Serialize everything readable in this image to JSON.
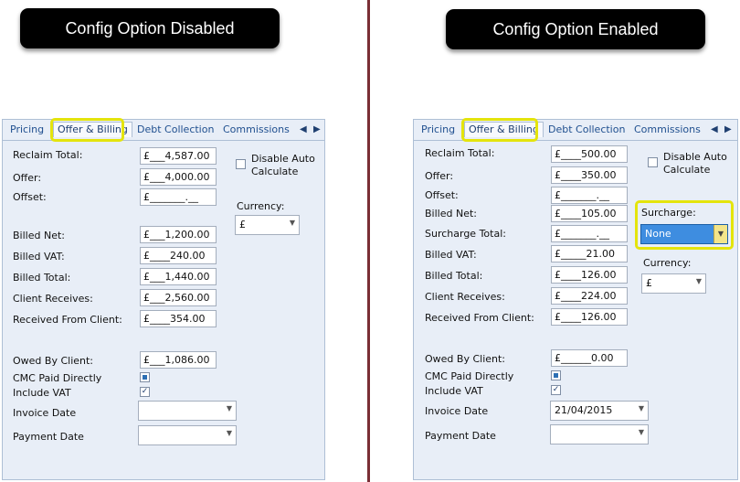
{
  "callouts": {
    "left": "Config Option Disabled",
    "right": "Config Option Enabled"
  },
  "tabs": {
    "pricing": "Pricing",
    "offer_billing": "Offer & Billing",
    "debt_collection": "Debt Collection",
    "commissions": "Commissions"
  },
  "left": {
    "labels": {
      "reclaim_total": "Reclaim Total:",
      "offer": "Offer:",
      "offset": "Offset:",
      "billed_net": "Billed Net:",
      "billed_vat": "Billed VAT:",
      "billed_total": "Billed Total:",
      "client_receives": "Client Receives:",
      "received_from_client": "Received From Client:",
      "owed_by_client": "Owed By Client:",
      "cmc_paid_directly": "CMC Paid Directly",
      "include_vat": "Include VAT",
      "invoice_date": "Invoice Date",
      "payment_date": "Payment Date",
      "disable_auto_calc": "Disable Auto\nCalculate",
      "currency": "Currency:"
    },
    "values": {
      "reclaim_total": "£___4,587.00",
      "offer": "£___4,000.00",
      "offset": "£_______.__",
      "billed_net": "£___1,200.00",
      "billed_vat": "£____240.00",
      "billed_total": "£___1,440.00",
      "client_receives": "£___2,560.00",
      "received_from_client": "£____354.00",
      "owed_by_client": "£___1,086.00",
      "currency": "£",
      "invoice_date": "",
      "payment_date": ""
    }
  },
  "right": {
    "labels": {
      "reclaim_total": "Reclaim Total:",
      "offer": "Offer:",
      "offset": "Offset:",
      "billed_net": "Billed Net:",
      "surcharge_total": "Surcharge Total:",
      "billed_vat": "Billed VAT:",
      "billed_total": "Billed Total:",
      "client_receives": "Client Receives:",
      "received_from_client": "Received From Client:",
      "owed_by_client": "Owed By Client:",
      "cmc_paid_directly": "CMC Paid Directly",
      "include_vat": "Include VAT",
      "invoice_date": "Invoice Date",
      "payment_date": "Payment Date",
      "disable_auto_calc": "Disable Auto\nCalculate",
      "surcharge": "Surcharge:",
      "currency": "Currency:"
    },
    "values": {
      "reclaim_total": "£____500.00",
      "offer": "£____350.00",
      "offset": "£_______.__",
      "billed_net": "£____105.00",
      "surcharge_total": "£_______.__",
      "billed_vat": "£_____21.00",
      "billed_total": "£____126.00",
      "client_receives": "£____224.00",
      "received_from_client": "£____126.00",
      "owed_by_client": "£______0.00",
      "invoice_date": "21/04/2015",
      "payment_date": "",
      "surcharge": "None",
      "currency": "£"
    }
  },
  "colors": {
    "highlight": "#e4e40c",
    "panel_bg": "#e8eef7",
    "divider": "#7a2e35",
    "selected_dropdown": "#3e8de0"
  },
  "icons": {
    "tab_prev": "chevron-left-icon",
    "tab_next": "chevron-right-icon",
    "dropdown": "caret-down-icon",
    "checkbox_checked": "check-icon"
  }
}
